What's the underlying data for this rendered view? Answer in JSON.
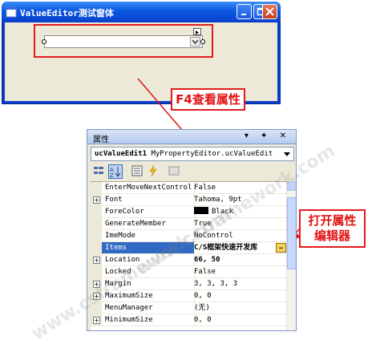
{
  "window": {
    "title": "ValueEditor测试窗体",
    "buttons": [
      "minimize",
      "maximize",
      "close"
    ],
    "title_bar_color": "#0b57e3",
    "body_color": "#ece9d8"
  },
  "callouts": {
    "f4": "F4查看属性",
    "open_editor_line1": "打开属性",
    "open_editor_line2": "编辑器",
    "color": "#e41b1b"
  },
  "property_panel": {
    "title": "属性",
    "header_icons": "▾ ✦ ✕",
    "selected_object_name": "ucValueEdit1",
    "selected_object_type": "MyPropertyEditor.ucValueEdit",
    "toolbar_icons": [
      "categorized-icon",
      "alphabetical-icon",
      "properties-icon",
      "events-icon",
      "property-pages-icon"
    ],
    "rows": [
      {
        "name": "EnterMoveNextControl",
        "value": "False",
        "expandable": false
      },
      {
        "name": "Font",
        "value": "Tahoma, 9pt",
        "expandable": true
      },
      {
        "name": "ForeColor",
        "value": "Black",
        "expandable": false,
        "swatch": "#000000"
      },
      {
        "name": "GenerateMember",
        "value": "True",
        "expandable": false
      },
      {
        "name": "ImeMode",
        "value": "NoControl",
        "expandable": false
      },
      {
        "name": "Items",
        "value": "C/S框架快速开发库",
        "expandable": false,
        "selected": true
      },
      {
        "name": "Location",
        "value": "66, 50",
        "expandable": true,
        "bold": true
      },
      {
        "name": "Locked",
        "value": "False",
        "expandable": false
      },
      {
        "name": "Margin",
        "value": "3, 3, 3, 3",
        "expandable": true
      },
      {
        "name": "MaximumSize",
        "value": "0, 0",
        "expandable": true
      },
      {
        "name": "MenuManager",
        "value": "(无)",
        "expandable": false
      },
      {
        "name": "MinimumSize",
        "value": "0, 0",
        "expandable": true
      }
    ]
  },
  "watermark": "www.csframework.com"
}
